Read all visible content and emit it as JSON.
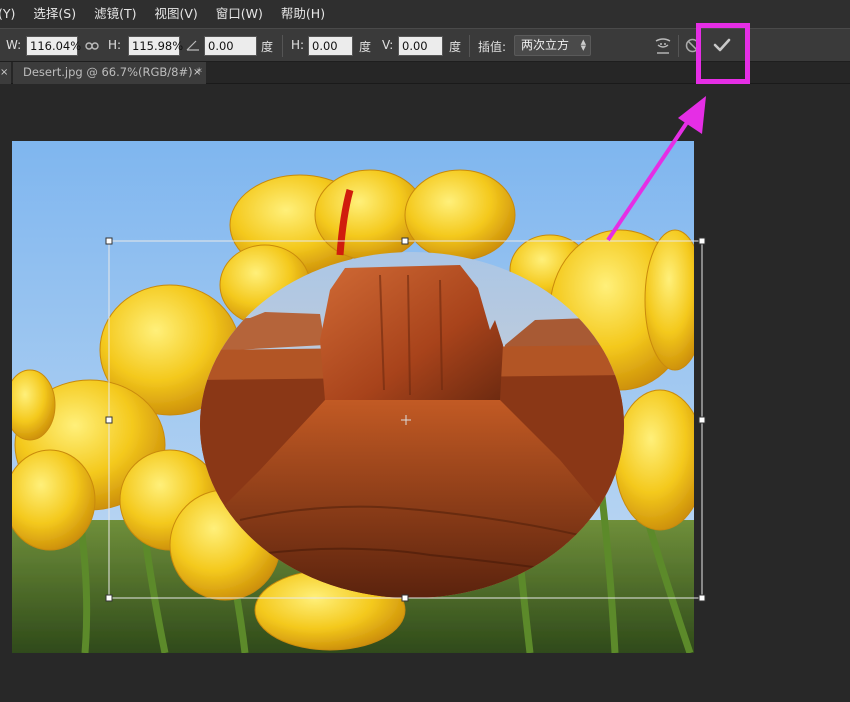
{
  "menubar": {
    "items": [
      "(Y)",
      "选择(S)",
      "滤镜(T)",
      "视图(V)",
      "窗口(W)",
      "帮助(H)"
    ]
  },
  "options": {
    "w_label": "W:",
    "w_value": "116.04%",
    "link_icon": "link-icon",
    "h_label": "H:",
    "h_value": "115.98%",
    "angle_icon": "angle-icon",
    "angle_value": "0.00",
    "angle_unit": "度",
    "hskew_label": "H:",
    "hskew_value": "0.00",
    "hskew_unit": "度",
    "vskew_label": "V:",
    "vskew_value": "0.00",
    "vskew_unit": "度",
    "interp_label": "插值:",
    "interp_value": "两次立方",
    "warp_icon": "warp-icon",
    "cancel_icon": "cancel-icon",
    "commit_icon": "checkmark-icon"
  },
  "tabs": {
    "title": "Desert.jpg @ 66.7%(RGB/8#) *",
    "close": "×",
    "prev_close": "×"
  },
  "colors": {
    "annotation": "#e52ee5",
    "sky": "#8cbff0",
    "tulip": "#f2c21a",
    "rock": "#b0461c"
  }
}
